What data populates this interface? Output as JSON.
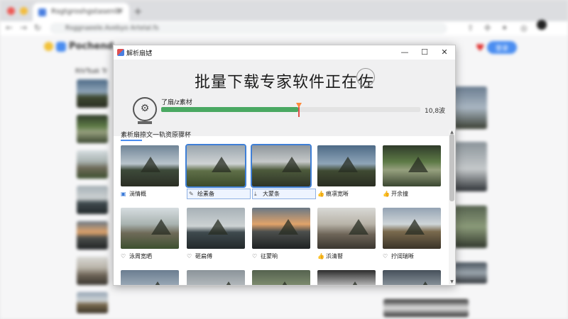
{
  "browser": {
    "tab_title": "Rsgtgroshgstasenlb",
    "omnibox": "Rsggnaeele.Avebyo Artelal.fs",
    "site_logo": "Pochend",
    "side_label": "RIVTsak Tr",
    "signup_label": "登录"
  },
  "dialog": {
    "window_title": "解析扇姑",
    "headline": "批量下载专家软件正在佐",
    "status_text": "了扇/z素材",
    "progress_percent": 53,
    "progress_size": "10,8波",
    "section_label": "素析扇捺文一轨资原骤杯",
    "items": [
      {
        "label": "淌情概",
        "icon": "tile-icon",
        "selected": false
      },
      {
        "label": "绘素备",
        "icon": "pencil-icon",
        "selected": true
      },
      {
        "label": "大蒙条",
        "icon": "download-icon",
        "selected": true
      },
      {
        "label": "痕凛宽晰",
        "icon": "thumb-icon",
        "selected": false
      },
      {
        "label": "开余撞",
        "icon": "thumb-icon",
        "selected": false
      },
      {
        "label": "泳周宽晒",
        "icon": "heart-icon",
        "selected": false
      },
      {
        "label": "砸扁傅",
        "icon": "heart-icon",
        "selected": false
      },
      {
        "label": "征蒙晌",
        "icon": "heart-icon",
        "selected": false
      },
      {
        "label": "浜清瞽",
        "icon": "thumb-icon",
        "selected": false
      },
      {
        "label": "拧阔瑞晰",
        "icon": "heart-icon",
        "selected": false
      },
      {
        "label": "",
        "icon": "",
        "selected": false
      },
      {
        "label": "",
        "icon": "",
        "selected": false
      },
      {
        "label": "",
        "icon": "",
        "selected": false
      },
      {
        "label": "",
        "icon": "",
        "selected": false
      },
      {
        "label": "",
        "icon": "",
        "selected": false
      }
    ]
  }
}
